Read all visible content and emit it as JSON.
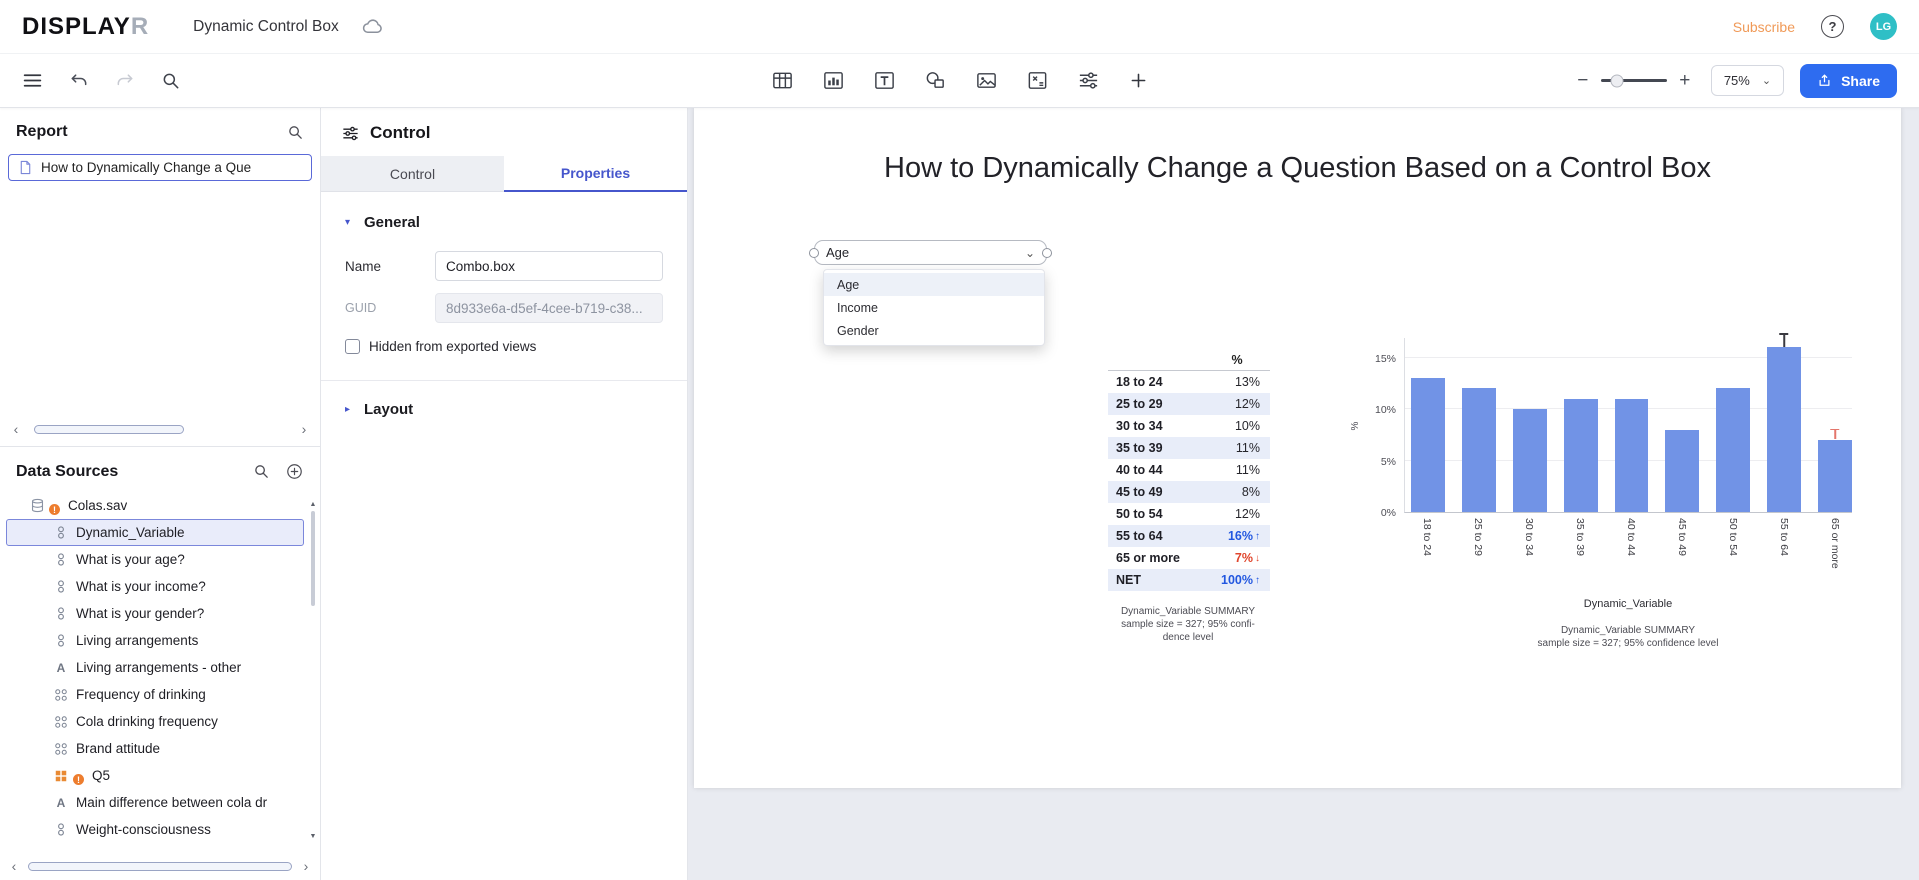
{
  "glyphs": {
    "chevron_down": "⌄",
    "triangle_down": "▾",
    "triangle_right": "▸",
    "scroll_left": "‹",
    "scroll_right": "›",
    "scroll_up": "▲",
    "scroll_down": "▼",
    "plus": "+",
    "minus": "−",
    "sig_up": "↑",
    "sig_down": "↓",
    "help": "?",
    "warning": "!"
  },
  "header": {
    "logo_primary": "DISPLAY",
    "logo_accent": "R",
    "document_title": "Dynamic Control Box",
    "subscribe_label": "Subscribe",
    "avatar_initials": "LG"
  },
  "toolbar": {
    "left_icons": [
      "menu",
      "undo",
      "redo",
      "search"
    ],
    "insert_icons": [
      "table",
      "visualization",
      "text",
      "shapes",
      "image",
      "calculation",
      "control",
      "add"
    ],
    "zoom_value": "75%",
    "share_label": "Share"
  },
  "report_panel": {
    "title": "Report",
    "pages": [
      {
        "label": "How to Dynamically Change a Que"
      }
    ]
  },
  "data_sources": {
    "title": "Data Sources",
    "items": [
      {
        "label": "Colas.sav",
        "icon": "database",
        "warning": true,
        "indent": 0
      },
      {
        "label": "Dynamic_Variable",
        "icon": "nominal",
        "indent": 1,
        "selected": true
      },
      {
        "label": "What is your age?",
        "icon": "nominal",
        "indent": 1
      },
      {
        "label": "What is your income?",
        "icon": "nominal",
        "indent": 1
      },
      {
        "label": "What is your gender?",
        "icon": "nominal",
        "indent": 1
      },
      {
        "label": "Living arrangements",
        "icon": "nominal",
        "indent": 1
      },
      {
        "label": "Living arrangements - other",
        "icon": "text-variable",
        "indent": 1
      },
      {
        "label": "Frequency of drinking",
        "icon": "pickany",
        "indent": 1
      },
      {
        "label": "Cola drinking frequency",
        "icon": "pickany",
        "indent": 1
      },
      {
        "label": "Brand attitude",
        "icon": "pickany",
        "indent": 1
      },
      {
        "label": "Q5",
        "icon": "pickany-orange",
        "warning": true,
        "indent": 1
      },
      {
        "label": "Main difference between cola dr",
        "icon": "text-variable",
        "indent": 1
      },
      {
        "label": "Weight-consciousness",
        "icon": "nominal",
        "indent": 1
      }
    ]
  },
  "control_panel": {
    "title": "Control",
    "tabs": [
      {
        "label": "Control",
        "active": false
      },
      {
        "label": "Properties",
        "active": true
      }
    ],
    "sections": {
      "general": {
        "title": "General",
        "fields": [
          {
            "label": "Name",
            "value": "Combo.box",
            "readonly": false
          },
          {
            "label": "GUID",
            "value": "8d933e6a-d5ef-4cee-b719-c38...",
            "readonly": true
          }
        ],
        "checkbox_label": "Hidden from exported views",
        "checkbox_checked": false
      },
      "layout": {
        "title": "Layout"
      }
    }
  },
  "canvas": {
    "page_title": "How to Dynamically Change a Question Based on a Control Box",
    "combo": {
      "value": "Age",
      "options": [
        "Age",
        "Income",
        "Gender"
      ]
    }
  },
  "chart_data": [
    {
      "type": "table",
      "columns": [
        "",
        "%"
      ],
      "rows": [
        {
          "label": "18 to 24",
          "value": "13%"
        },
        {
          "label": "25 to 29",
          "value": "12%"
        },
        {
          "label": "30 to 34",
          "value": "10%"
        },
        {
          "label": "35 to 39",
          "value": "11%"
        },
        {
          "label": "40 to 44",
          "value": "11%"
        },
        {
          "label": "45 to 49",
          "value": "8%"
        },
        {
          "label": "50 to 54",
          "value": "12%"
        },
        {
          "label": "55 to 64",
          "value": "16%",
          "significance": "up"
        },
        {
          "label": "65 or more",
          "value": "7%",
          "significance": "down"
        },
        {
          "label": "NET",
          "value": "100%",
          "significance": "up"
        }
      ],
      "footer_lines": [
        "Dynamic_Variable SUMMARY",
        "sample size = 327; 95% confi-",
        "dence level"
      ]
    },
    {
      "type": "bar",
      "categories": [
        "18 to 24",
        "25 to 29",
        "30 to 34",
        "35 to 39",
        "40 to 44",
        "45 to 49",
        "50 to 54",
        "55 to 64",
        "65 or more"
      ],
      "values": [
        13,
        12,
        10,
        11,
        11,
        8,
        12,
        16,
        7
      ],
      "bar_color": "#7193e6",
      "xlabel": "Dynamic_Variable",
      "ylabel": "%",
      "ylim": [
        0,
        17
      ],
      "yticks": [
        {
          "label": "0%",
          "value": 0
        },
        {
          "label": "5%",
          "value": 5
        },
        {
          "label": "10%",
          "value": 10
        },
        {
          "label": "15%",
          "value": 15
        }
      ],
      "grid": true,
      "legend": "none",
      "significance": {
        "55 to 64": "up",
        "65 or more": "down"
      },
      "footer_lines": [
        "Dynamic_Variable SUMMARY",
        "sample size = 327; 95% confidence level"
      ]
    }
  ]
}
